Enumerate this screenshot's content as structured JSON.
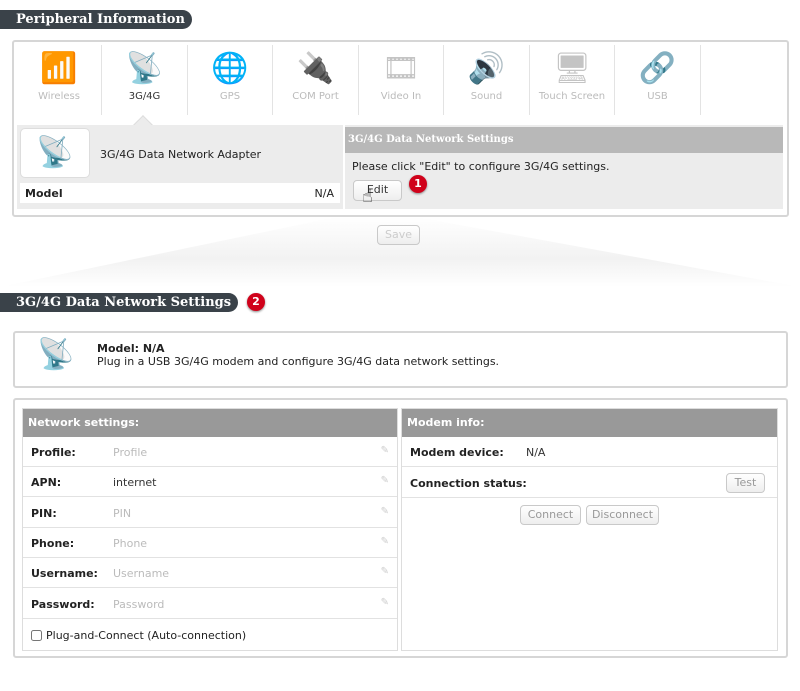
{
  "peripheral": {
    "title": "Peripheral Information",
    "tabs": [
      {
        "label": "Wireless",
        "icon": "router-icon"
      },
      {
        "label": "3G/4G",
        "icon": "cell-tower-icon",
        "active": true
      },
      {
        "label": "GPS",
        "icon": "globe-search-icon"
      },
      {
        "label": "COM Port",
        "icon": "serial-cable-icon"
      },
      {
        "label": "Video In",
        "icon": "av-cable-icon"
      },
      {
        "label": "Sound",
        "icon": "speaker-icon"
      },
      {
        "label": "Touch Screen",
        "icon": "touch-screen-icon"
      },
      {
        "label": "USB",
        "icon": "usb-icon"
      }
    ],
    "device_name": "3G/4G Data Network Adapter",
    "model_label": "Model",
    "model_value": "N/A",
    "settings_title": "3G/4G Data Network Settings",
    "settings_hint": "Please click \"Edit\" to configure 3G/4G settings.",
    "edit_label": "Edit",
    "badge1": "1",
    "save_label": "Save"
  },
  "network": {
    "title": "3G/4G Data Network Settings",
    "badge2": "2",
    "model_line": "Model: N/A",
    "description": "Plug in a USB 3G/4G modem and configure 3G/4G data network settings.",
    "settings_header": "Network settings:",
    "fields": [
      {
        "label": "Profile:",
        "value": "",
        "placeholder": "Profile"
      },
      {
        "label": "APN:",
        "value": "internet",
        "placeholder": ""
      },
      {
        "label": "PIN:",
        "value": "",
        "placeholder": "PIN"
      },
      {
        "label": "Phone:",
        "value": "",
        "placeholder": "Phone"
      },
      {
        "label": "Username:",
        "value": "",
        "placeholder": "Username"
      },
      {
        "label": "Password:",
        "value": "",
        "placeholder": "Password"
      }
    ],
    "auto_connect_label": "Plug-and-Connect (Auto-connection)",
    "auto_connect_checked": false,
    "modem_header": "Modem info:",
    "modem_device_label": "Modem device:",
    "modem_device_value": "N/A",
    "connection_status_label": "Connection status:",
    "test_label": "Test",
    "connect_label": "Connect",
    "disconnect_label": "Disconnect"
  }
}
